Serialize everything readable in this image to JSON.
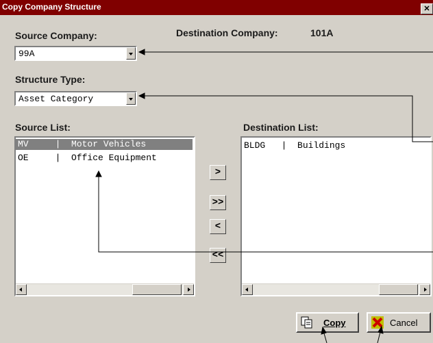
{
  "window": {
    "title": "Copy Company Structure",
    "close_glyph": "✕"
  },
  "source_company": {
    "label": "Source Company:",
    "value": "99A"
  },
  "destination_company": {
    "label": "Destination Company:",
    "value": "101A"
  },
  "structure_type": {
    "label": "Structure Type:",
    "value": "Asset Category"
  },
  "source_list": {
    "label": "Source List:",
    "items": [
      {
        "text": "MV     |  Motor Vehicles",
        "selected": true
      },
      {
        "text": "OE     |  Office Equipment",
        "selected": false
      }
    ]
  },
  "destination_list": {
    "label": "Destination List:",
    "items": [
      {
        "text": "BLDG   |  Buildings",
        "selected": false
      }
    ]
  },
  "move_buttons": {
    "add_one": ">",
    "add_all": ">>",
    "remove_one": "<",
    "remove_all": "<<"
  },
  "buttons": {
    "copy": "Copy",
    "cancel": "Cancel"
  },
  "icons": {
    "copy": "copy-document-icon",
    "cancel": "cancel-x-icon"
  },
  "colors": {
    "title_bar": "#800000",
    "dialog_bg": "#d4d0c8",
    "selection": "#808080"
  }
}
